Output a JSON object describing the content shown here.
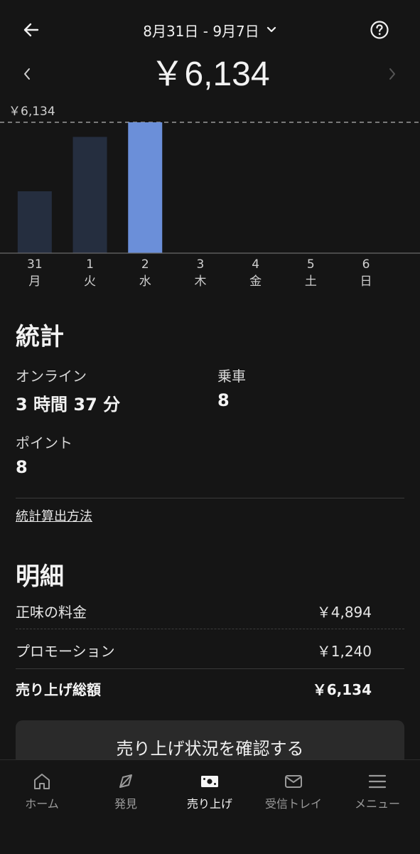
{
  "header": {
    "date_range": "8月31日 - 9月7日",
    "total": "￥6,134",
    "back_icon": "arrow-left-icon",
    "help_icon": "question-circle-icon",
    "dropdown_icon": "chevron-down-icon",
    "prev_icon": "chevron-left-icon",
    "next_icon": "chevron-right-icon"
  },
  "chart_data": {
    "type": "bar",
    "max_label": "￥6,134",
    "categories": [
      {
        "day": "31",
        "weekday": "月"
      },
      {
        "day": "1",
        "weekday": "火"
      },
      {
        "day": "2",
        "weekday": "水"
      },
      {
        "day": "3",
        "weekday": "木"
      },
      {
        "day": "4",
        "weekday": "金"
      },
      {
        "day": "5",
        "weekday": "土"
      },
      {
        "day": "6",
        "weekday": "日"
      }
    ],
    "values": [
      2900,
      5450,
      6134,
      0,
      0,
      0,
      0
    ],
    "ylim": [
      0,
      6134
    ],
    "selected_index": 2,
    "colors": {
      "bar": "#252e3f",
      "selected_bar": "#6b8fd9",
      "reference_line": "#9a9a9a",
      "baseline": "#6a6a6a"
    }
  },
  "stats": {
    "title": "統計",
    "online_label": "オンライン",
    "online_value": "3 時間 37 分",
    "rides_label": "乗車",
    "rides_value": "8",
    "points_label": "ポイント",
    "points_value": "8",
    "method_link": "統計算出方法"
  },
  "breakdown": {
    "title": "明細",
    "rows": [
      {
        "label": "正味の料金",
        "value": "￥4,894"
      },
      {
        "label": "プロモーション",
        "value": "￥1,240"
      },
      {
        "label": "売り上げ総額",
        "value": "￥6,134"
      }
    ]
  },
  "cta": {
    "label": "売り上げ状況を確認する"
  },
  "nav": {
    "items": [
      {
        "label": "ホーム",
        "icon": "home-icon"
      },
      {
        "label": "発見",
        "icon": "compass-icon"
      },
      {
        "label": "売り上げ",
        "icon": "earnings-icon"
      },
      {
        "label": "受信トレイ",
        "icon": "mail-icon"
      },
      {
        "label": "メニュー",
        "icon": "menu-icon"
      }
    ],
    "active_index": 2
  }
}
